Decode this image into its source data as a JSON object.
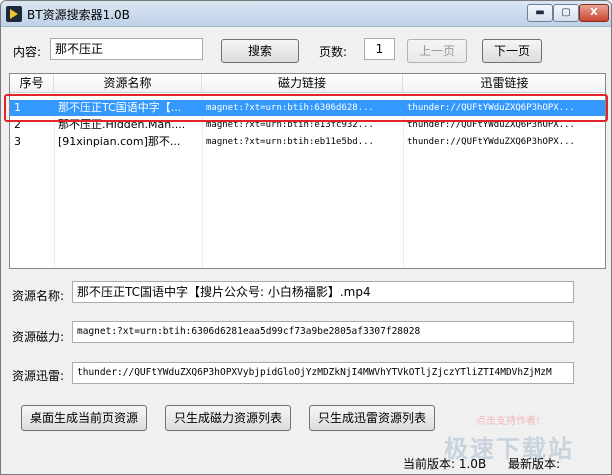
{
  "window": {
    "title": "BT资源搜索器1.0B",
    "min_glyph": "▬",
    "max_glyph": "▢",
    "close_glyph": "X"
  },
  "search": {
    "content_label": "内容:",
    "content_value": "那不压正",
    "search_button": "搜索",
    "page_label": "页数:",
    "page_value": "1",
    "prev_button": "上一页",
    "next_button": "下一页"
  },
  "list": {
    "headers": [
      "序号",
      "资源名称",
      "磁力链接",
      "迅雷链接"
    ],
    "rows": [
      [
        "1",
        "那不压正TC国语中字【...",
        "magnet:?xt=urn:btih:6306d628...",
        "thunder://QUFtYWduZXQ6P3hOPX..."
      ],
      [
        "2",
        "那不压正.Hidden.Man....",
        "magnet:?xt=urn:btih:e13fc932...",
        "thunder://QUFtYWduZXQ6P3hOPX..."
      ],
      [
        "3",
        "[91xinpian.com]那不...",
        "magnet:?xt=urn:btih:eb11e5bd...",
        "thunder://QUFtYWduZXQ6P3hOPX..."
      ]
    ],
    "selected_row": 0
  },
  "details": {
    "name_label": "资源名称:",
    "name_value": "那不压正TC国语中字【搜片公众号: 小白杨福影】.mp4",
    "magnet_label": "资源磁力:",
    "magnet_value": "magnet:?xt=urn:btih:6306d6281eaa5d99cf73a9be2805af3307f28028",
    "thunder_label": "资源迅雷:",
    "thunder_value": "thunder://QUFtYWduZXQ6P3hOPXVybjpidGloOjYzMDZkNjI4MWVhYTVkOTljZjczYTliZTI4MDVhZjMzM"
  },
  "actions": {
    "desktop_button": "桌面生成当前页资源",
    "magnet_list_button": "只生成磁力资源列表",
    "thunder_list_button": "只生成迅雷资源列表"
  },
  "status": {
    "current_version": "当前版本: 1.0B",
    "latest_version": "最新版本:"
  },
  "watermark": {
    "hint": "点击支持作者!",
    "brand": "极速下载站"
  }
}
